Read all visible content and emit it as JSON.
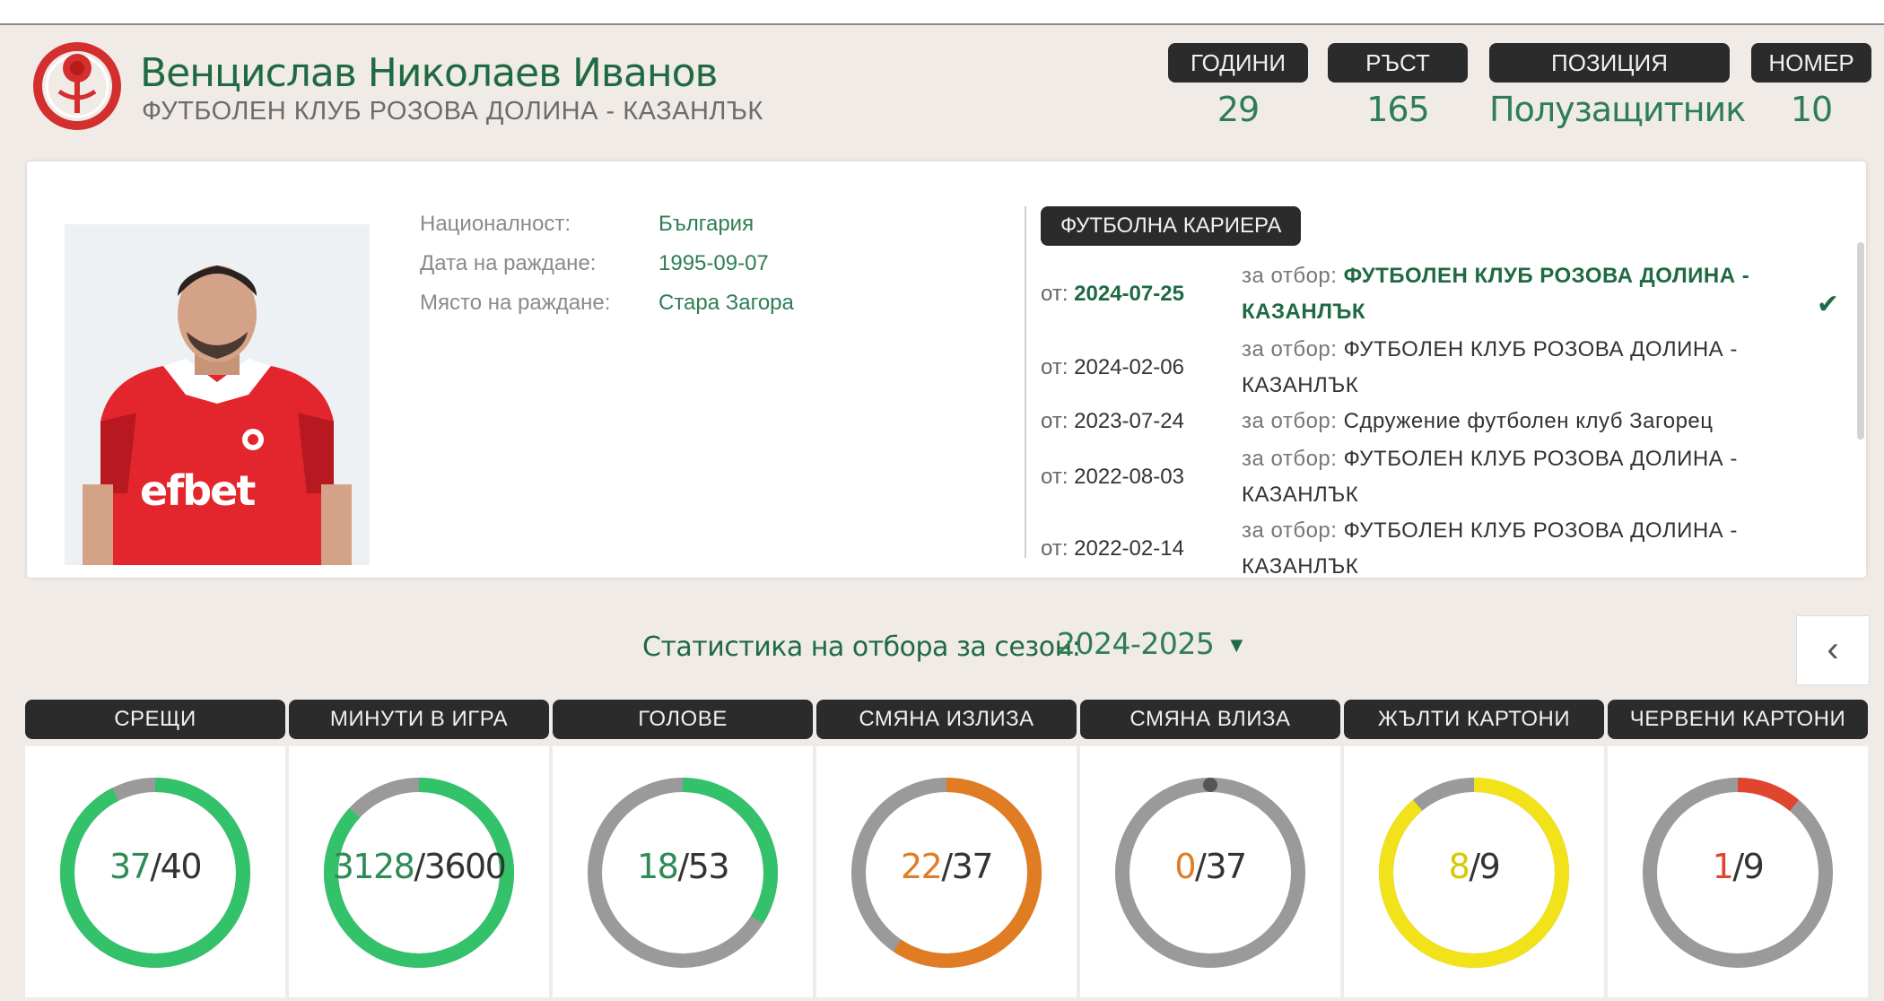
{
  "header": {
    "player_name": "Венцислав Николаев Иванов",
    "club_name": "ФУТБОЛЕН КЛУБ РОЗОВА ДОЛИНА - КАЗАНЛЪК",
    "info": [
      {
        "label": "ГОДИНИ",
        "value": "29"
      },
      {
        "label": "РЪСТ",
        "value": "165"
      },
      {
        "label": "ПОЗИЦИЯ",
        "value": "Полузащитник"
      },
      {
        "label": "НОМЕР",
        "value": "10"
      }
    ]
  },
  "profile": {
    "photo_jersey_text": "efbet",
    "nationality_label": "Националност:",
    "nationality": "България",
    "birthdate_label": "Дата на раждане:",
    "birthdate": "1995-09-07",
    "birthplace_label": "Място на раждане:",
    "birthplace": "Стара Загора"
  },
  "career": {
    "title": "ФУТБОЛНА КАРИЕРА",
    "from_prefix": "от:",
    "team_prefix": "за отбор:",
    "items": [
      {
        "date": "2024-07-25",
        "team": "ФУТБОЛЕН КЛУБ РОЗОВА ДОЛИНА - КАЗАНЛЪК",
        "current": true
      },
      {
        "date": "2024-02-06",
        "team": "ФУТБОЛЕН КЛУБ РОЗОВА ДОЛИНА - КАЗАНЛЪК",
        "current": false
      },
      {
        "date": "2023-07-24",
        "team": "Сдружение футболен клуб Загорец",
        "current": false
      },
      {
        "date": "2022-08-03",
        "team": "ФУТБОЛЕН КЛУБ РОЗОВА ДОЛИНА - КАЗАНЛЪК",
        "current": false
      },
      {
        "date": "2022-02-14",
        "team": "ФУТБОЛЕН КЛУБ РОЗОВА ДОЛИНА - КАЗАНЛЪК",
        "current": false
      }
    ]
  },
  "stats": {
    "season_label": "Статистика на отбора за сезон:",
    "season": "2024-2025",
    "items": [
      {
        "label": "СРЕЩИ",
        "value": 37,
        "total": 40,
        "color": "#33c16a"
      },
      {
        "label": "МИНУТИ В ИГРА",
        "value": 3128,
        "total": 3600,
        "color": "#33c16a"
      },
      {
        "label": "ГОЛОВЕ",
        "value": 18,
        "total": 53,
        "color": "#33c16a"
      },
      {
        "label": "СМЯНА ИЗЛИЗА",
        "value": 22,
        "total": 37,
        "color": "#e07c24"
      },
      {
        "label": "СМЯНА ВЛИЗА",
        "value": 0,
        "total": 37,
        "color": "#e07c24"
      },
      {
        "label": "ЖЪЛТИ КАРТОНИ",
        "value": 8,
        "total": 9,
        "color": "#f2e21a"
      },
      {
        "label": "ЧЕРВЕНИ КАРТОНИ",
        "value": 1,
        "total": 9,
        "color": "#e0452f"
      }
    ]
  },
  "colors": {
    "brand_green": "#1f6a42",
    "label_dark": "#2b2b2b",
    "ring_track": "#9a9a9a"
  }
}
